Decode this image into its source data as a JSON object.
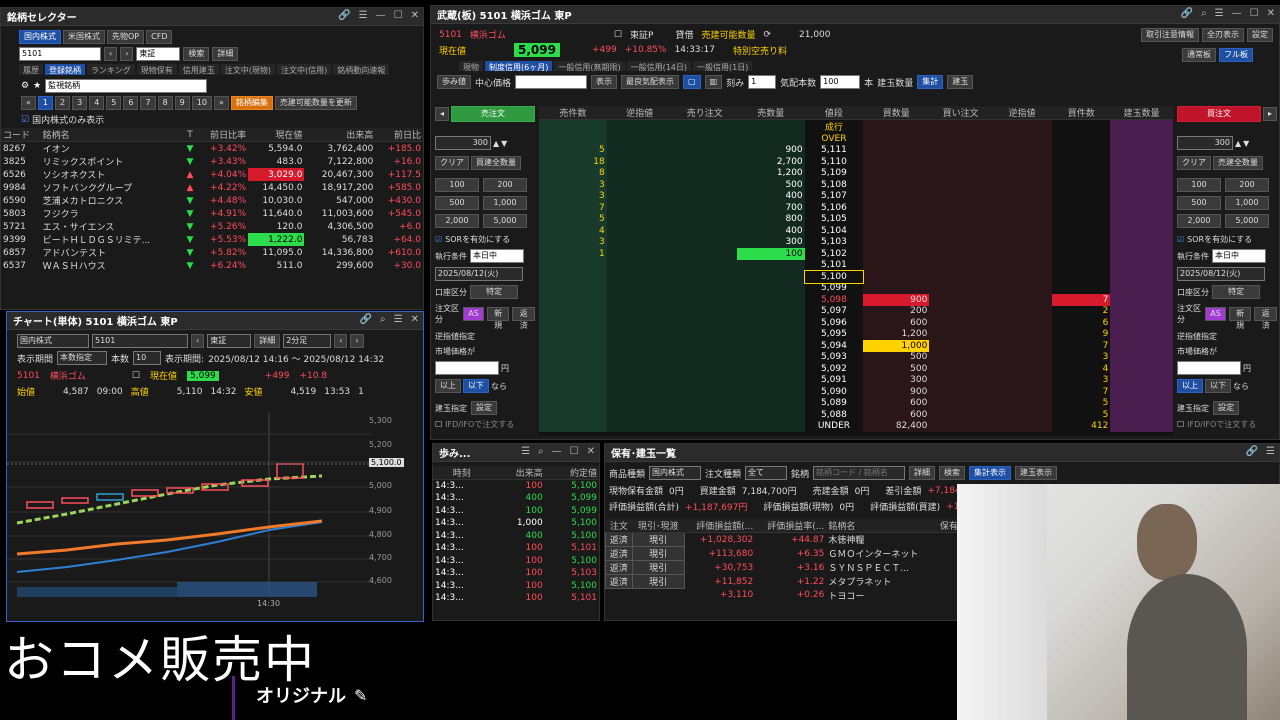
{
  "sel": {
    "title": "銘柄セレクター",
    "tabs": [
      "国内株式",
      "米国株式",
      "先物OP",
      "CFD"
    ],
    "code": "5101",
    "exch": "東証",
    "search": "検索",
    "detail": "詳細",
    "subtabs": [
      "履歴",
      "登録銘柄",
      "ランキング",
      "現物保有",
      "信用建玉",
      "注文中(現物)",
      "注文中(信用)",
      "銘柄動向速報"
    ],
    "watch": "監視銘柄",
    "pages": [
      "1",
      "2",
      "3",
      "4",
      "5",
      "6",
      "7",
      "8",
      "9",
      "10"
    ],
    "edit": "銘柄編集",
    "upd": "売建可能数量を更新",
    "chk": "国内株式のみ表示",
    "cols": [
      "コード",
      "銘柄名",
      "T",
      "前日比率",
      "現在値",
      "出来高",
      "前日比"
    ],
    "rows": [
      [
        "8267",
        "イオン",
        "▼",
        "+3.42%",
        "5,594.0",
        "3,762,400",
        "+185.0"
      ],
      [
        "3825",
        "リミックスポイント",
        "▼",
        "+3.43%",
        "483.0",
        "7,122,800",
        "+16.0"
      ],
      [
        "6526",
        "ソシオネクスト",
        "▲",
        "+4.04%",
        "3,029.0",
        "20,467,300",
        "+117.5"
      ],
      [
        "9984",
        "ソフトバンクグループ",
        "▲",
        "+4.22%",
        "14,450.0",
        "18,917,200",
        "+585.0"
      ],
      [
        "6590",
        "芝浦メカトロニクス",
        "▼",
        "+4.48%",
        "10,030.0",
        "547,000",
        "+430.0"
      ],
      [
        "5803",
        "フジクラ",
        "▼",
        "+4.91%",
        "11,640.0",
        "11,003,600",
        "+545.0"
      ],
      [
        "5721",
        "エス・サイエンス",
        "▼",
        "+5.26%",
        "120.0",
        "4,306,500",
        "+6.0"
      ],
      [
        "9399",
        "ビートＨＬＤＧＳリミテ...",
        "▼",
        "+5.53%",
        "1,222.0",
        "56,783",
        "+64.0"
      ],
      [
        "6857",
        "アドバンテスト",
        "▼",
        "+5.82%",
        "11,095.0",
        "14,336,800",
        "+610.0"
      ],
      [
        "6537",
        "ＷＡＳＨハウス",
        "▼",
        "+6.24%",
        "511.0",
        "299,600",
        "+30.0"
      ]
    ]
  },
  "chart": {
    "title": "チャート(単体) 5101 横浜ゴム 東P",
    "mkt": "国内株式",
    "code": "5101",
    "exch": "東証",
    "detail": "詳細",
    "intv": "2分足",
    "period_lbl": "表示期間",
    "period": "本数指定",
    "count_lbl": "本数",
    "count": "10",
    "range_lbl": "表示期間:",
    "range": "2025/08/12 14:16 ～ 2025/08/12 14:32",
    "name": "横浜ゴム",
    "price_lbl": "現在値",
    "price": "5,099",
    "chg": "+499",
    "pct": "+10.8",
    "o_lbl": "始値",
    "o": "4,587",
    "ot": "09:00",
    "h_lbl": "高値",
    "h": "5,110",
    "ht": "14:32",
    "l_lbl": "安値",
    "l": "4,519",
    "lt": "13:53",
    "one": "1",
    "yticks": [
      "5,300",
      "5,200",
      "5,000",
      "4,900",
      "4,800",
      "4,700",
      "4,600"
    ],
    "cur": "5,100.0",
    "xtick": "14:30"
  },
  "board": {
    "title": "武蔵(板) 5101 横浜ゴム 東P",
    "b1": "取引注意情報",
    "b2": "全刃表示",
    "b3": "設定",
    "b4": "通常板",
    "b5": "フル板",
    "code": "5101",
    "name": "横浜ゴム",
    "mkt": "東証P",
    "lend_lbl": "貸借",
    "lend": "売建可能数量",
    "shortfee": "特別空売り料",
    "q": "21,000",
    "cur_lbl": "現在値",
    "price": "5,099",
    "chg": "+499",
    "pct": "+10.85%",
    "time": "14:33:17",
    "tabs": [
      "現物",
      "制度信用(6ヶ月)",
      "一般信用(無期限)",
      "一般信用(14日)",
      "一般信用(1日)"
    ],
    "ctrl": [
      "歩み値",
      "中心価格",
      "表示",
      "最良気配表示",
      "刻み",
      "気配本数",
      "100",
      "本",
      "建玉数量",
      "集計",
      "建玉"
    ],
    "cols": [
      "売件数",
      "逆指値",
      "売り注文",
      "売数量",
      "値段",
      "買数量",
      "買い注文",
      "逆指値",
      "買件数",
      "建玉数量"
    ],
    "sellbtn": "売注文",
    "buybtn": "買注文",
    "qty": "300",
    "clear": "クリア",
    "allqty": "買建全数量",
    "allqty_s": "売建全数量",
    "qbtns": [
      "100",
      "200",
      "500",
      "1,000",
      "2,000",
      "5,000"
    ],
    "sor": "SORを有効にする",
    "cond_lbl": "執行条件",
    "cond": "本日中",
    "date": "2025/08/12(火)",
    "acct_lbl": "口座区分",
    "acct": "特定",
    "ord_lbl": "注文区分",
    "as": "AS",
    "new": "新規",
    "close": "返済",
    "stop": "逆指値指定",
    "mkt_lbl": "市場価格が",
    "yen": "円",
    "above": "以上",
    "below": "以下",
    "nara": "なら",
    "tate": "建玉指定",
    "set": "設定",
    "ifd": "IFD/IFOで注文する",
    "rows": [
      [
        "",
        "",
        "",
        "",
        "成行",
        "",
        "",
        "",
        "",
        ""
      ],
      [
        "",
        "",
        "",
        "",
        "OVER",
        "",
        "",
        "",
        "",
        ""
      ],
      [
        "5",
        "",
        "",
        "900",
        "5,111",
        "",
        "",
        "",
        "",
        ""
      ],
      [
        "18",
        "",
        "",
        "2,700",
        "5,110",
        "",
        "",
        "",
        "",
        ""
      ],
      [
        "8",
        "",
        "",
        "1,200",
        "5,109",
        "",
        "",
        "",
        "",
        ""
      ],
      [
        "3",
        "",
        "",
        "500",
        "5,108",
        "",
        "",
        "",
        "",
        ""
      ],
      [
        "3",
        "",
        "",
        "400",
        "5,107",
        "",
        "",
        "",
        "",
        ""
      ],
      [
        "7",
        "",
        "",
        "700",
        "5,106",
        "",
        "",
        "",
        "",
        ""
      ],
      [
        "5",
        "",
        "",
        "800",
        "5,105",
        "",
        "",
        "",
        "",
        ""
      ],
      [
        "4",
        "",
        "",
        "400",
        "5,104",
        "",
        "",
        "",
        "",
        ""
      ],
      [
        "3",
        "",
        "",
        "300",
        "5,103",
        "",
        "",
        "",
        "",
        ""
      ],
      [
        "1",
        "",
        "",
        "100",
        "5,102",
        "",
        "",
        "",
        "",
        ""
      ],
      [
        "",
        "",
        "",
        "",
        "5,101",
        "",
        "",
        "",
        "",
        ""
      ],
      [
        "",
        "",
        "",
        "",
        "5,100",
        "",
        "",
        "",
        "",
        ""
      ],
      [
        "",
        "",
        "",
        "",
        "5,099",
        "",
        "",
        "",
        "",
        ""
      ],
      [
        "",
        "",
        "",
        "",
        "5,098",
        "900",
        "",
        "",
        "7",
        ""
      ],
      [
        "",
        "",
        "",
        "",
        "5,097",
        "200",
        "",
        "",
        "2",
        ""
      ],
      [
        "",
        "",
        "",
        "",
        "5,096",
        "600",
        "",
        "",
        "6",
        ""
      ],
      [
        "",
        "",
        "",
        "",
        "5,095",
        "1,200",
        "",
        "",
        "9",
        ""
      ],
      [
        "",
        "",
        "",
        "",
        "5,094",
        "1,000",
        "",
        "",
        "7",
        ""
      ],
      [
        "",
        "",
        "",
        "",
        "5,093",
        "500",
        "",
        "",
        "3",
        ""
      ],
      [
        "",
        "",
        "",
        "",
        "5,092",
        "500",
        "",
        "",
        "4",
        ""
      ],
      [
        "",
        "",
        "",
        "",
        "5,091",
        "300",
        "",
        "",
        "3",
        ""
      ],
      [
        "",
        "",
        "",
        "",
        "5,090",
        "900",
        "",
        "",
        "7",
        ""
      ],
      [
        "",
        "",
        "",
        "",
        "5,089",
        "600",
        "",
        "",
        "5",
        ""
      ],
      [
        "",
        "",
        "",
        "",
        "5,088",
        "600",
        "",
        "",
        "5",
        ""
      ],
      [
        "",
        "",
        "",
        "",
        "UNDER",
        "82,400",
        "",
        "",
        "412",
        ""
      ]
    ]
  },
  "ayumi": {
    "title": "歩み...",
    "cols": [
      "時刻",
      "出来高",
      "約定値"
    ],
    "rows": [
      [
        "14:3...",
        "100",
        "5,100"
      ],
      [
        "14:3...",
        "400",
        "5,099"
      ],
      [
        "14:3...",
        "100",
        "5,099"
      ],
      [
        "14:3...",
        "1,000",
        "5,100"
      ],
      [
        "14:3...",
        "400",
        "5,100"
      ],
      [
        "14:3...",
        "100",
        "5,101"
      ],
      [
        "14:3...",
        "100",
        "5,100"
      ],
      [
        "14:3...",
        "100",
        "5,103"
      ],
      [
        "14:3...",
        "100",
        "5,100"
      ],
      [
        "14:3...",
        "100",
        "5,101"
      ]
    ]
  },
  "hold": {
    "title": "保有･建玉一覧",
    "prod_lbl": "商品種類",
    "prod": "国内株式",
    "otype_lbl": "注文種類",
    "otype": "全て",
    "sym_lbl": "銘柄",
    "sym_ph": "銘柄コード / 銘柄名",
    "detail": "詳細",
    "search": "検索",
    "agg": "集計表示",
    "tate": "建玉表示",
    "s1": "現物保有金額",
    "s1v": "0円",
    "s2": "買建金額",
    "s2v": "7,184,700円",
    "s3": "売建金額",
    "s3v": "0円",
    "s4": "差引金額",
    "s4v": "+7,184",
    "s5": "評価損益額(合計)",
    "s5v": "+1,187,697円",
    "s6": "評価損益額(現物)",
    "s6v": "0円",
    "s7": "評価損益額(買建)",
    "s7v": "+1,18",
    "cols": [
      "注文",
      "現引･現渡",
      "評価損益額(...",
      "評価損益率(...",
      "銘柄名",
      "保有/"
    ],
    "rows": [
      [
        "返済",
        "現引",
        "+1,028,302",
        "+44.87",
        "木徳神糧"
      ],
      [
        "返済",
        "現引",
        "+113,680",
        "+6.35",
        "ＧＭＯインターネット"
      ],
      [
        "返済",
        "現引",
        "+30,753",
        "+3.16",
        "ＳＹＮＳＰＥＣＴ..."
      ],
      [
        "返済",
        "現引",
        "+11,852",
        "+1.22",
        "メタプラネット"
      ],
      [
        "",
        "",
        "+3,110",
        "+0.26",
        "トヨコー"
      ]
    ]
  },
  "overlay": {
    "big": "おコメ販売中",
    "sub": "オリジナル"
  },
  "colors": {
    "up": "#ff4d5a",
    "down": "#2cdc4a",
    "accent": "#1e4fa3"
  }
}
